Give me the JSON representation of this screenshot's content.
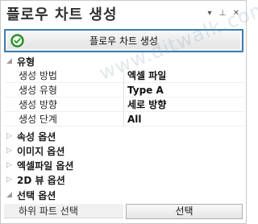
{
  "window": {
    "title": "플로우 차트 생성",
    "controls": {
      "dropdown": "▾",
      "pin": "⊥",
      "close": "✕"
    }
  },
  "create_button": {
    "label": "플로우 차트 생성",
    "icon": "check-circle-icon",
    "icon_color": "#2e9e2e"
  },
  "grid": {
    "section_type": {
      "label": "유형",
      "expanded": true
    },
    "props": [
      {
        "name": "생성 방법",
        "value": "엑셀 파일"
      },
      {
        "name": "생성 유형",
        "value": "Type A"
      },
      {
        "name": "생성 방향",
        "value": "세로 방향"
      },
      {
        "name": "생성 단계",
        "value": "All"
      }
    ],
    "collapsed_sections": [
      {
        "label": "속성 옵션"
      },
      {
        "label": "이미지 옵션"
      },
      {
        "label": "엑셀파일 옵션"
      },
      {
        "label": "2D 뷰 옵션"
      }
    ],
    "section_select": {
      "label": "선택 옵션",
      "expanded": true
    },
    "select_prop": {
      "name": "하위 파트 선택",
      "button": "선택"
    }
  },
  "watermark": "www.ditwalk.com",
  "colors": {
    "button_border": "#3c7fb1",
    "check_green": "#2e9e2e"
  }
}
